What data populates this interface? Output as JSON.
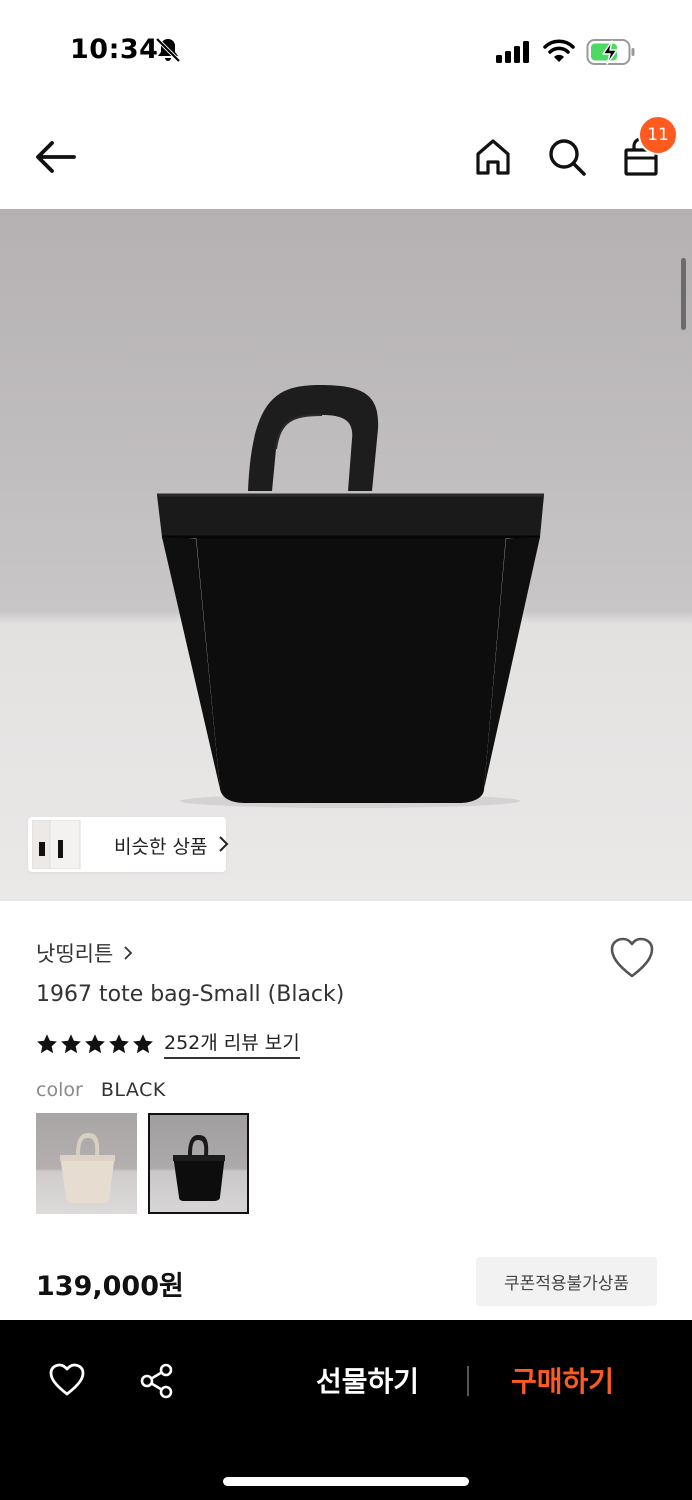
{
  "status_bar": {
    "time": "10:34",
    "icons": [
      "bell-slash-icon",
      "cellular-signal-icon",
      "wifi-icon",
      "battery-charging-icon"
    ]
  },
  "nav": {
    "icons": [
      "arrow-left-icon",
      "home-icon",
      "search-icon",
      "shopping-bag-icon"
    ],
    "cart_count": "11"
  },
  "product": {
    "similar_label": "비슷한 상품",
    "brand": "낫띵리튼",
    "title": "1967 tote bag-Small (Black)",
    "rating_stars": 5,
    "review_link": "252개 리뷰 보기",
    "color_label": "color",
    "color_value": "BLACK",
    "swatches": [
      {
        "name": "beige",
        "selected": false
      },
      {
        "name": "black",
        "selected": true
      }
    ],
    "price": "139,000원",
    "coupon_note": "쿠폰적용불가상품"
  },
  "bottom_bar": {
    "gift_label": "선물하기",
    "buy_label": "구매하기",
    "icons": [
      "heart-icon",
      "share-icon"
    ]
  },
  "colors": {
    "accent": "#ff5a1f",
    "bottom_bar_bg": "#000000"
  }
}
